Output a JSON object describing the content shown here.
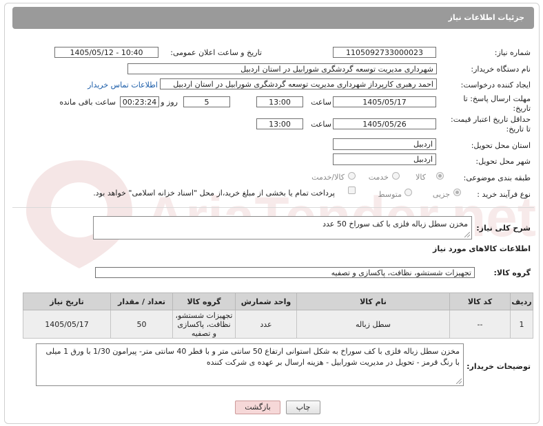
{
  "header": {
    "title": "جزئیات اطلاعات نیاز"
  },
  "form": {
    "need_number": {
      "label": "شماره نیاز:",
      "value": "1105092733000023"
    },
    "announce_date": {
      "label": "تاریخ و ساعت اعلان عمومی:",
      "value": "1405/05/12 - 10:40"
    },
    "buyer_org": {
      "label": "نام دستگاه خریدار:",
      "value": "شهرداری مدیریت توسعه گردشگری شورابیل در استان اردبیل"
    },
    "creator": {
      "label": "ایجاد کننده درخواست:",
      "value": "احمد رهبری کارپرداز شهرداری مدیریت توسعه گردشگری شورابیل در استان اردبیل",
      "link": "اطلاعات تماس خریدار"
    },
    "reply_deadline": {
      "label_line1": "مهلت ارسال پاسخ: تا",
      "label_line2": "تاریخ:",
      "date": "1405/05/17",
      "time_label": "ساعت",
      "time": "13:00",
      "days": "5",
      "days_label": "روز و",
      "remaining": "00:23:24",
      "remaining_label": "ساعت باقی مانده"
    },
    "price_validity": {
      "label_line1": "حداقل تاریخ اعتبار قیمت:",
      "label_line2": "تا تاریخ:",
      "date": "1405/05/26",
      "time_label": "ساعت",
      "time": "13:00"
    },
    "delivery_province": {
      "label": "استان محل تحویل:",
      "value": "اردبیل"
    },
    "delivery_city": {
      "label": "شهر محل تحویل:",
      "value": "اردبیل"
    },
    "category": {
      "label": "طبقه بندی موضوعی:",
      "options": [
        "کالا",
        "خدمت",
        "کالا/خدمت"
      ],
      "selected": "کالا"
    },
    "purchase_process": {
      "label": "نوع فرآیند خرید :",
      "options": [
        "جزیی",
        "متوسط"
      ],
      "selected": "جزیی",
      "checkbox_text": "پرداخت تمام یا بخشی از مبلغ خرید،از محل \"اسناد خزانه اسلامی\" خواهد بود."
    }
  },
  "summary": {
    "label": "شرح کلی نیاز:",
    "value": "مخزن سطل زباله فلزی با کف سوراخ 50 عدد"
  },
  "goods_section": {
    "title": "اطلاعات کالاهای مورد نیاز"
  },
  "goods_group": {
    "label": "گروه کالا:",
    "value": "تجهیزات شستشو، نظافت، پاکسازی و تصفیه"
  },
  "table": {
    "headers": [
      "ردیف",
      "کد کالا",
      "نام کالا",
      "واحد شمارش",
      "گروه کالا",
      "تعداد / مقدار",
      "تاریخ نیاز"
    ],
    "rows": [
      [
        "1",
        "--",
        "سطل زباله",
        "عدد",
        "تجهیزات شستشو، نظافت، پاکسازی و تصفیه",
        "50",
        "1405/05/17"
      ]
    ]
  },
  "buyer_notes": {
    "label": "توضیحات خریدار:",
    "value": "مخزن سطل زباله فلزی با کف سوراخ به شکل استوانی ارتفاع 50 سانتی متر و با قطر 40 سانتی متر- پیرامون 1/30 با ورق 1 میلی با رنگ قرمز - تحویل در مدیریت شورابیل - هزینه ارسال بر عهده ی شرکت کننده"
  },
  "buttons": {
    "print": "چاپ",
    "back": "بازگشت"
  },
  "watermark": {
    "text": "AriaTender.net"
  }
}
